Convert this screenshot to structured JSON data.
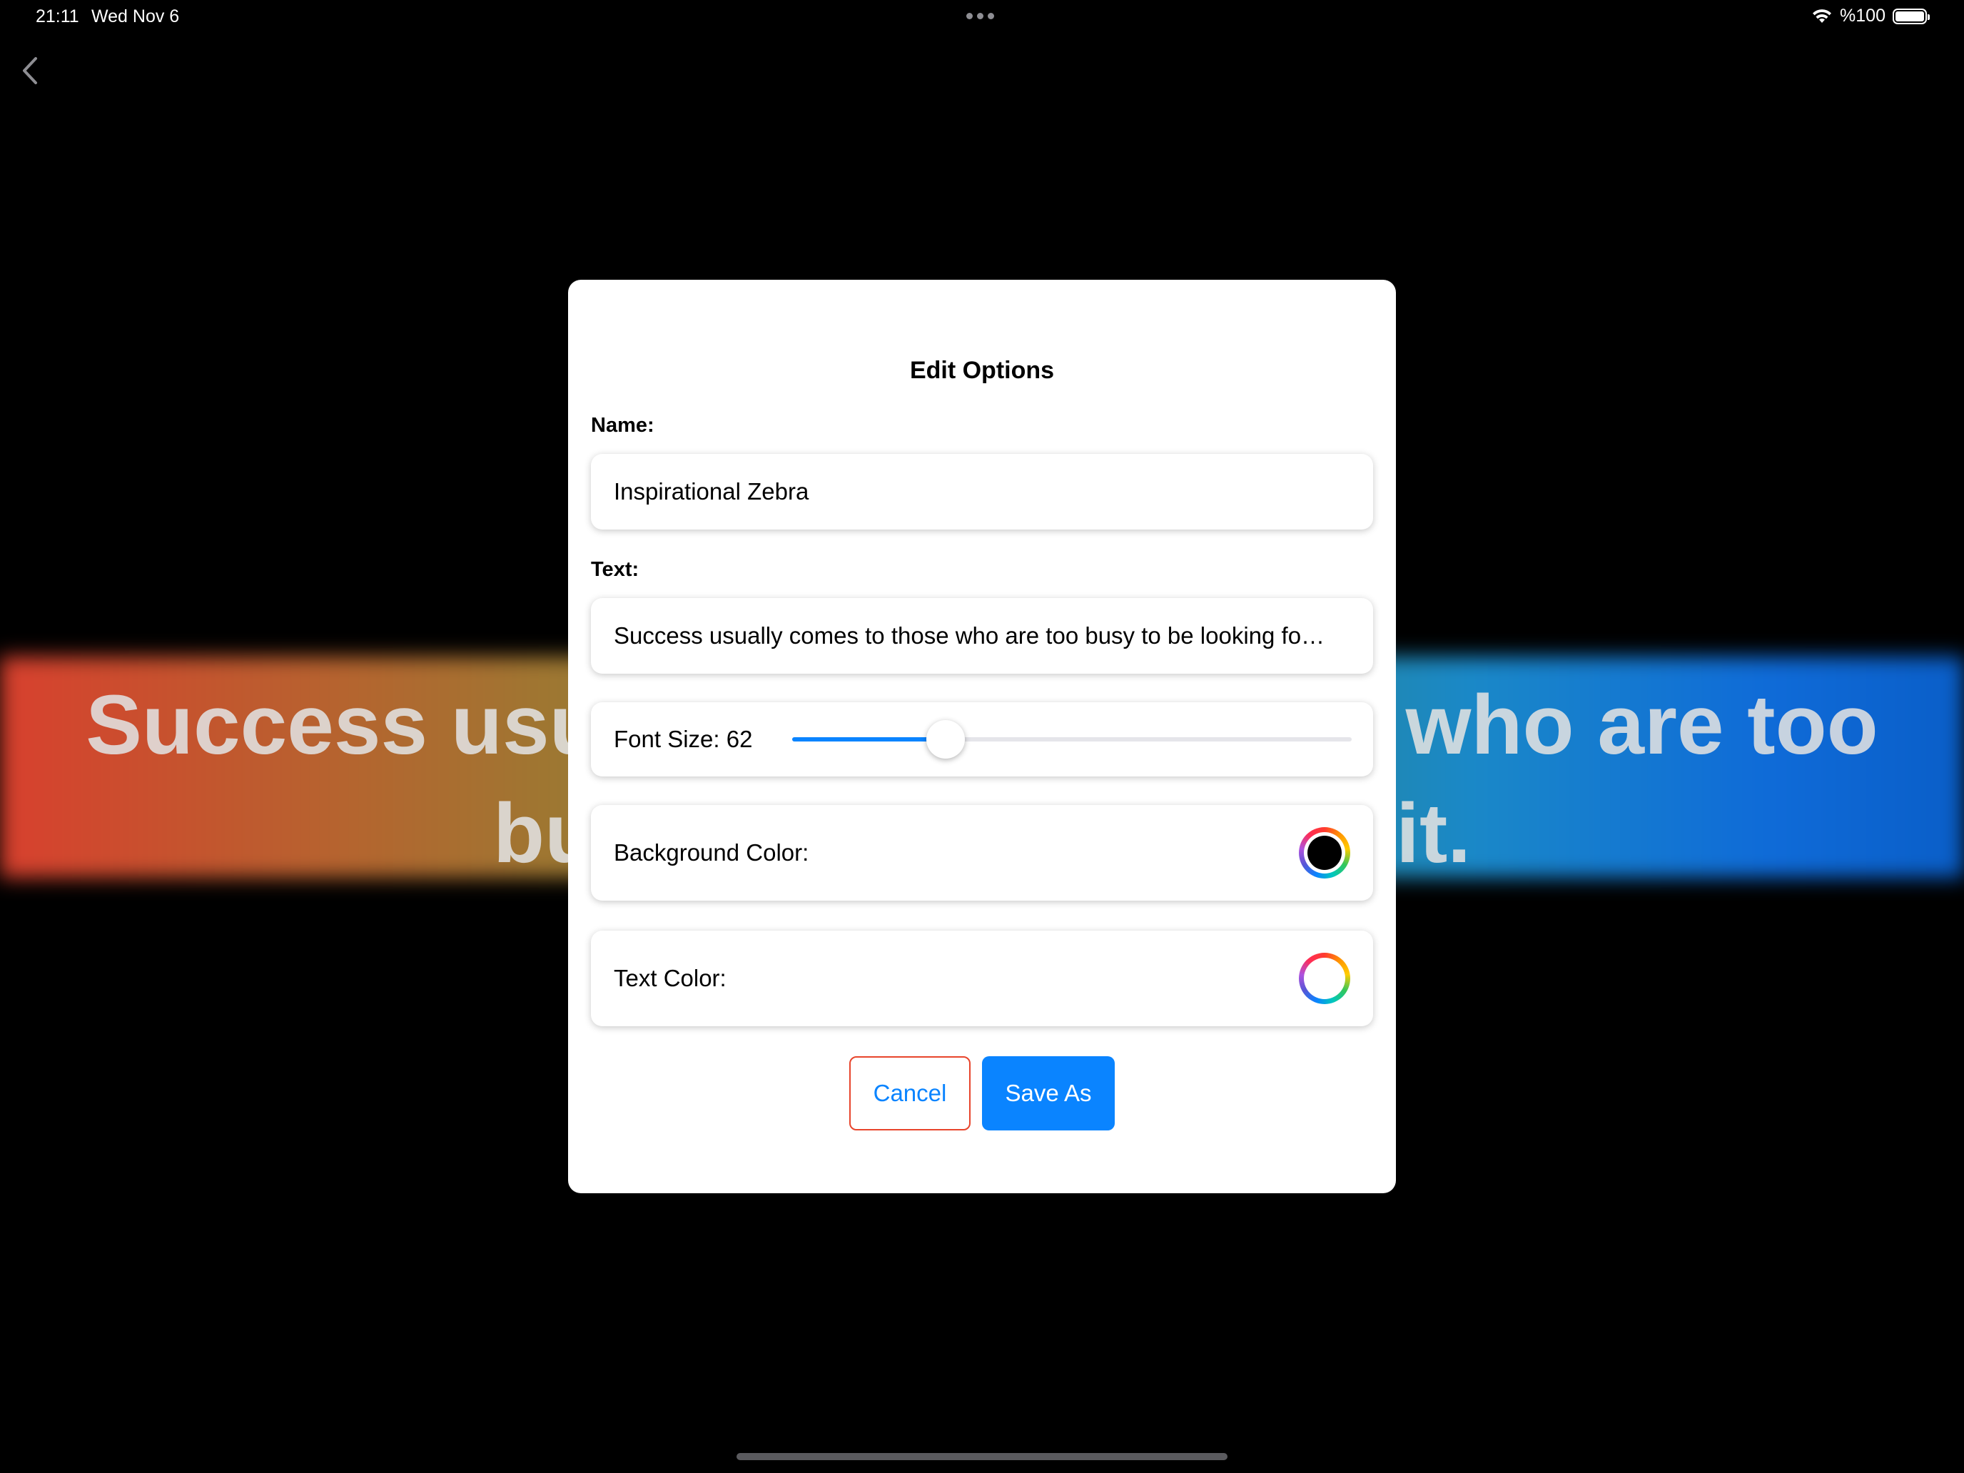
{
  "status_bar": {
    "time": "21:11",
    "date": "Wed Nov 6",
    "battery": "%100"
  },
  "background": {
    "quote": "Success usually comes to those who are too busy to be looking for it."
  },
  "modal": {
    "title": "Edit Options",
    "name_label": "Name:",
    "name_value": "Inspirational Zebra",
    "text_label": "Text:",
    "text_value": "Success usually comes to those who are too busy to be looking fo…",
    "font_size_label": "Font Size: 62",
    "font_size_slider": {
      "min": 10,
      "max": 200,
      "value": 62
    },
    "background_color_label": "Background Color:",
    "background_color_value": "#000000",
    "text_color_label": "Text Color:",
    "text_color_value": "#ffffff",
    "cancel_label": "Cancel",
    "save_label": "Save As"
  },
  "colors": {
    "accent": "#0a84ff",
    "cancel_border": "#e8452c"
  },
  "icons": {
    "back": "chevron-left-icon",
    "wifi": "wifi-icon",
    "battery": "battery-icon",
    "multitask": "ellipsis-icon"
  }
}
